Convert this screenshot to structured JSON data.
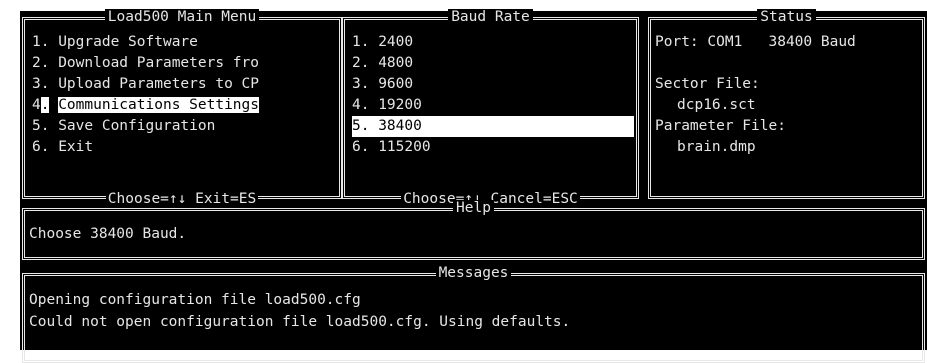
{
  "main_menu": {
    "title": "Load500 Main Menu",
    "items": [
      {
        "num": "1.",
        "label": "Upgrade Software"
      },
      {
        "num": "2.",
        "label": "Download Parameters fro"
      },
      {
        "num": "3.",
        "label": "Upload Parameters to CP"
      },
      {
        "num": "4.",
        "label": "Communications Settings"
      },
      {
        "num": "5.",
        "label": "Save Configuration"
      },
      {
        "num": "6.",
        "label": "Exit"
      }
    ],
    "footer": "Choose=↑↓ Exit=ES"
  },
  "baud_rate": {
    "title": "Baud Rate",
    "items": [
      {
        "num": "1.",
        "label": "2400"
      },
      {
        "num": "2.",
        "label": "4800"
      },
      {
        "num": "3.",
        "label": "9600"
      },
      {
        "num": "4.",
        "label": "19200"
      },
      {
        "num": "5.",
        "label": "38400"
      },
      {
        "num": "6.",
        "label": "115200"
      }
    ],
    "footer": "Choose=↑↓ Cancel=ESC"
  },
  "status": {
    "title": "Status",
    "port_line": "Port: COM1   38400 Baud",
    "sector_label": "Sector File:",
    "sector_value": "dcp16.sct",
    "param_label": "Parameter File:",
    "param_value": "brain.dmp"
  },
  "help": {
    "title": "Help",
    "text": "Choose 38400 Baud."
  },
  "messages": {
    "title": "Messages",
    "lines": [
      "Opening configuration file load500.cfg",
      "Could not open configuration file load500.cfg. Using defaults."
    ]
  },
  "colors": {
    "background": "#000000",
    "text": "#e6e6e6",
    "highlight": "#ffffff"
  }
}
